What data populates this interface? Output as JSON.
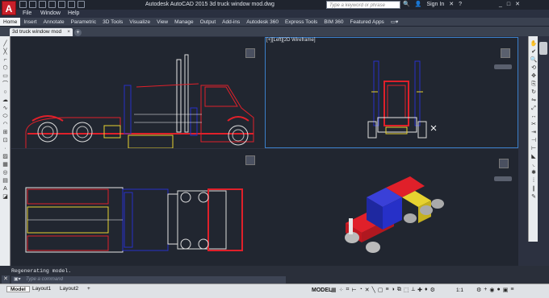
{
  "app": {
    "logo": "A",
    "title": "Autodesk AutoCAD 2015   3d truck window mod.dwg"
  },
  "search": {
    "placeholder": "Type a keyword or phrase"
  },
  "account": {
    "sign_in": "Sign In"
  },
  "menu": [
    "File",
    "Window",
    "Help"
  ],
  "ribbon_tabs": [
    "Home",
    "Insert",
    "Annotate",
    "Parametric",
    "3D Tools",
    "Visualize",
    "View",
    "Manage",
    "Output",
    "Add-ins",
    "Autodesk 360",
    "Express Tools",
    "BIM 360",
    "Featured Apps"
  ],
  "doc_tab": {
    "label": "3d truck window mod",
    "close": "×"
  },
  "viewport_top_right_label": "[+][Left][2D Wireframe]",
  "command": {
    "history": "Regenerating model.",
    "placeholder": "Type a command"
  },
  "status": {
    "tabs": [
      "Model",
      "Layout1",
      "Layout2"
    ],
    "mode": "MODEL",
    "scale": "1:1"
  },
  "colors": {
    "accent": "#3b7fc9",
    "truck_red": "#e0202a",
    "truck_blue": "#2630c8",
    "truck_yellow": "#e6d230"
  }
}
